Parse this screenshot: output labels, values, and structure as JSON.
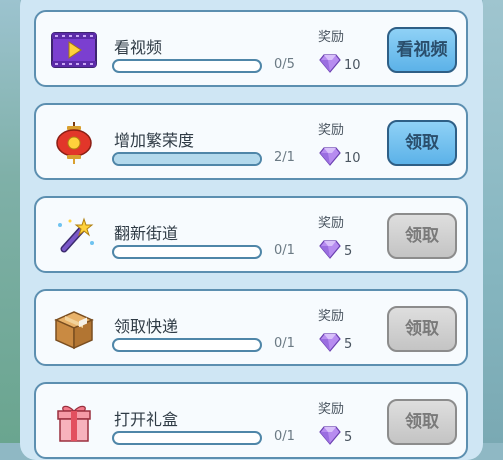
{
  "tasks": [
    {
      "title": "看视频",
      "progress_text": "0/5",
      "progress_fraction": 0.0,
      "reward_label": "奖励",
      "reward_amount": "10",
      "button_label": "看视频",
      "button_state": "active",
      "icon": "video-icon"
    },
    {
      "title": "增加繁荣度",
      "progress_text": "2/1",
      "progress_fraction": 1.0,
      "reward_label": "奖励",
      "reward_amount": "10",
      "button_label": "领取",
      "button_state": "active",
      "icon": "lantern-icon"
    },
    {
      "title": "翻新街道",
      "progress_text": "0/1",
      "progress_fraction": 0.0,
      "reward_label": "奖励",
      "reward_amount": "5",
      "button_label": "领取",
      "button_state": "disabled",
      "icon": "magic-wand-icon"
    },
    {
      "title": "领取快递",
      "progress_text": "0/1",
      "progress_fraction": 0.0,
      "reward_label": "奖励",
      "reward_amount": "5",
      "button_label": "领取",
      "button_state": "disabled",
      "icon": "package-icon"
    },
    {
      "title": "打开礼盒",
      "progress_text": "0/1",
      "progress_fraction": 0.0,
      "reward_label": "奖励",
      "reward_amount": "5",
      "button_label": "领取",
      "button_state": "disabled",
      "icon": "gift-box-icon"
    }
  ],
  "colors": {
    "active_button": "#5cb2e8",
    "disabled_button": "#c4c4c4",
    "card_border": "#5c8fb0",
    "progress_fill": "#b3d9ec",
    "gem": "#b78cf0"
  }
}
